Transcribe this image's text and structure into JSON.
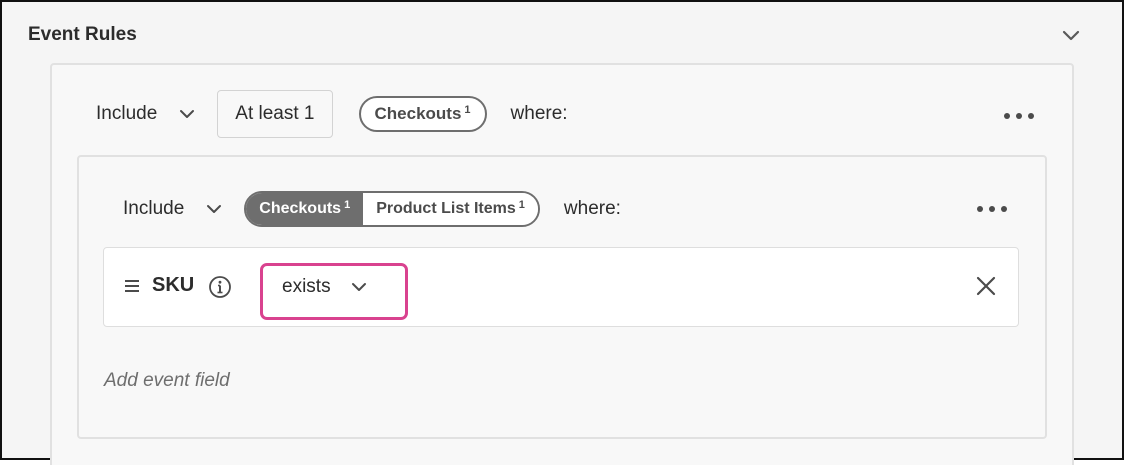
{
  "panel": {
    "title": "Event Rules",
    "collapse_icon": "chevron-down-icon"
  },
  "outer_rule": {
    "mode": "Include",
    "count": "At least 1",
    "event_tag": {
      "label": "Checkouts",
      "superscript": "1"
    },
    "where": "where:",
    "more_icon": "more-icon"
  },
  "inner_rule": {
    "mode": "Include",
    "segments": [
      {
        "label": "Checkouts",
        "superscript": "1",
        "active": true
      },
      {
        "label": "Product List Items",
        "superscript": "1",
        "active": false
      }
    ],
    "where": "where:",
    "more_icon": "more-icon"
  },
  "field": {
    "handle_icon": "drag-handle-icon",
    "name": "SKU",
    "info_icon": "info-icon",
    "operator": "exists",
    "remove_icon": "close-icon",
    "highlight_color": "#d9428f"
  },
  "add_field_label": "Add event field"
}
